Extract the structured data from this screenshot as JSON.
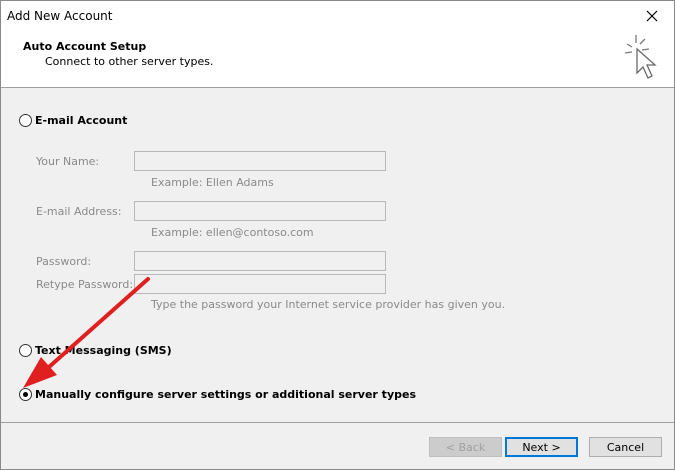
{
  "window": {
    "title": "Add New Account",
    "close_glyph": "✕"
  },
  "header": {
    "title": "Auto Account Setup",
    "subtitle": "Connect to other server types."
  },
  "options": {
    "email_account": {
      "label": "E-mail Account",
      "selected": false
    },
    "text_messaging": {
      "label": "Text Messaging (SMS)",
      "selected": false
    },
    "manual": {
      "label": "Manually configure server settings or additional server types",
      "selected": true
    }
  },
  "form": {
    "your_name": {
      "label": "Your Name:",
      "value": "",
      "hint": "Example: Ellen Adams"
    },
    "email_address": {
      "label": "E-mail Address:",
      "value": "",
      "hint": "Example: ellen@contoso.com"
    },
    "password": {
      "label": "Password:",
      "value": ""
    },
    "retype_password": {
      "label": "Retype Password:",
      "value": "",
      "hint": "Type the password your Internet service provider has given you."
    }
  },
  "buttons": {
    "back": "< Back",
    "next": "Next >",
    "cancel": "Cancel"
  },
  "colors": {
    "arrow": "#e02020",
    "default_button_border": "#0078d7",
    "disabled_text": "#8a8a8a"
  },
  "icons": {
    "wizard": "cursor-sparkle-icon",
    "close": "close-icon",
    "annotation": "red-arrow"
  }
}
